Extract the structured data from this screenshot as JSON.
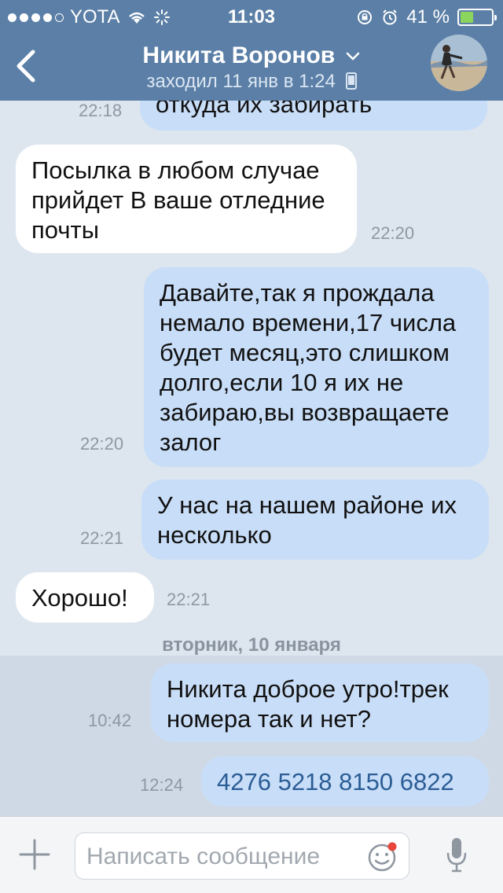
{
  "status_bar": {
    "carrier": "YOTA",
    "time": "11:03",
    "battery": "41 %",
    "battery_level": 0.41
  },
  "header": {
    "contact_name": "Никита Воронов",
    "last_seen": "заходил 11 янв в 1:24"
  },
  "messages": [
    {
      "direction": "out",
      "text": "откуда их забирать",
      "time": "22:18"
    },
    {
      "direction": "in",
      "text": "Посылка в любом случае прийдет В ваше отледние почты",
      "time": "22:20"
    },
    {
      "direction": "out",
      "text": "Давайте,так я прождала немало времени,17 числа будет месяц,это слишком долго,если 10 я их не забираю,вы возвращаете залог",
      "time": "22:20"
    },
    {
      "direction": "out",
      "text": "У нас на нашем районе их несколько",
      "time": "22:21"
    },
    {
      "direction": "in",
      "text": "Хорошо!",
      "time": "22:21"
    },
    {
      "direction": "out",
      "text": "Никита доброе утро!трек номера так и нет?",
      "time": "10:42"
    },
    {
      "direction": "out",
      "text": "4276 5218 8150 6822",
      "time": "12:24"
    }
  ],
  "date_separator": "вторник, 10 января",
  "composer": {
    "placeholder": "Написать сообщение"
  },
  "colors": {
    "header": "#5b7fa6",
    "chat_background": "#dde6ef",
    "outgoing_bubble": "#c8ddf7",
    "incoming_bubble": "#ffffff",
    "unread_highlight": "#cfd9e6",
    "number_link": "#2b5d96"
  }
}
